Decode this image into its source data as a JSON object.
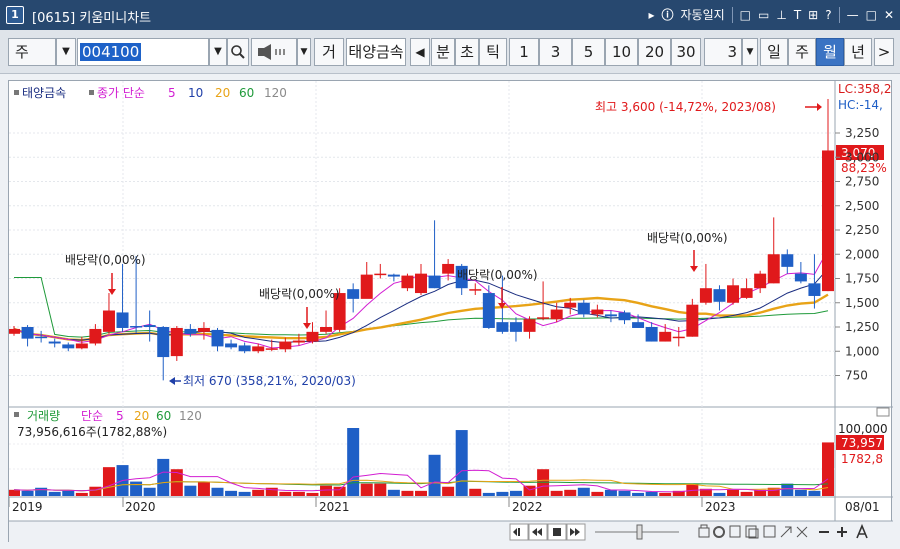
{
  "window": {
    "number": "1",
    "title": "[0615] 키움미니차트",
    "tools": [
      "▸",
      "자동일지",
      "□",
      "▭",
      "📌",
      "T",
      "⊞",
      "?",
      "—",
      "□",
      "✕"
    ]
  },
  "toolbar": {
    "market": "주",
    "code": "004100",
    "search_icon": "search-icon",
    "speaker_icon": "speaker-icon",
    "trade_btn": "거",
    "stock_name": "태양금속",
    "left_arrow": "◀",
    "periods": [
      "분",
      "초",
      "틱"
    ],
    "intervals": [
      "1",
      "3",
      "5",
      "10",
      "20",
      "30"
    ],
    "interval_value": "3",
    "ranges": [
      "일",
      "주",
      "월",
      "년"
    ],
    "active_range": "월",
    "next_arrow": ">"
  },
  "legend": {
    "stock": "태양금속",
    "price_type": "종가 단순",
    "ma_periods": [
      "5",
      "10",
      "20",
      "60",
      "120"
    ]
  },
  "price_axis": {
    "ticks": [
      "3,250",
      "3,000",
      "2,750",
      "2,500",
      "2,250",
      "2,000",
      "1,750",
      "1,500",
      "1,250",
      "1,000",
      "750"
    ],
    "lc": "LC:358,2",
    "hc": "HC:-14,",
    "current_price": "3,070",
    "current_pct": "88,23%"
  },
  "annotations": {
    "high": "최고 3,600 (-14,72%, 2023/08)",
    "low": "최저 670 (358,21%, 2020/03)",
    "dividends": [
      "배당락(0,00%)",
      "배당락(0,00%)",
      "배당락(0,00%)",
      "배당락(0,00%)"
    ]
  },
  "volume": {
    "legend_label": "거래량",
    "legend_ma": "단순",
    "ma_periods": [
      "5",
      "20",
      "60",
      "120"
    ],
    "info": "73,956,616주(1782,88%)",
    "axis_top": "100,000",
    "current": "73,957",
    "current_pct": "1782,8"
  },
  "x_axis": {
    "years": [
      "2019",
      "2020",
      "2021",
      "2022",
      "2023"
    ],
    "date_label": "08/01"
  },
  "colors": {
    "up": "#e0191b",
    "down": "#1f5fc6",
    "ma5": "#d21ed2",
    "ma10": "#1a2d80",
    "ma20": "#e8a317",
    "ma60": "#1f9a3a",
    "ma120": "#8a8a8a"
  },
  "chart_data": {
    "type": "candlestick",
    "interval": "monthly",
    "period": "2019-2023/08",
    "price_high": 3600,
    "price_low": 670,
    "last_close": 3070
  }
}
